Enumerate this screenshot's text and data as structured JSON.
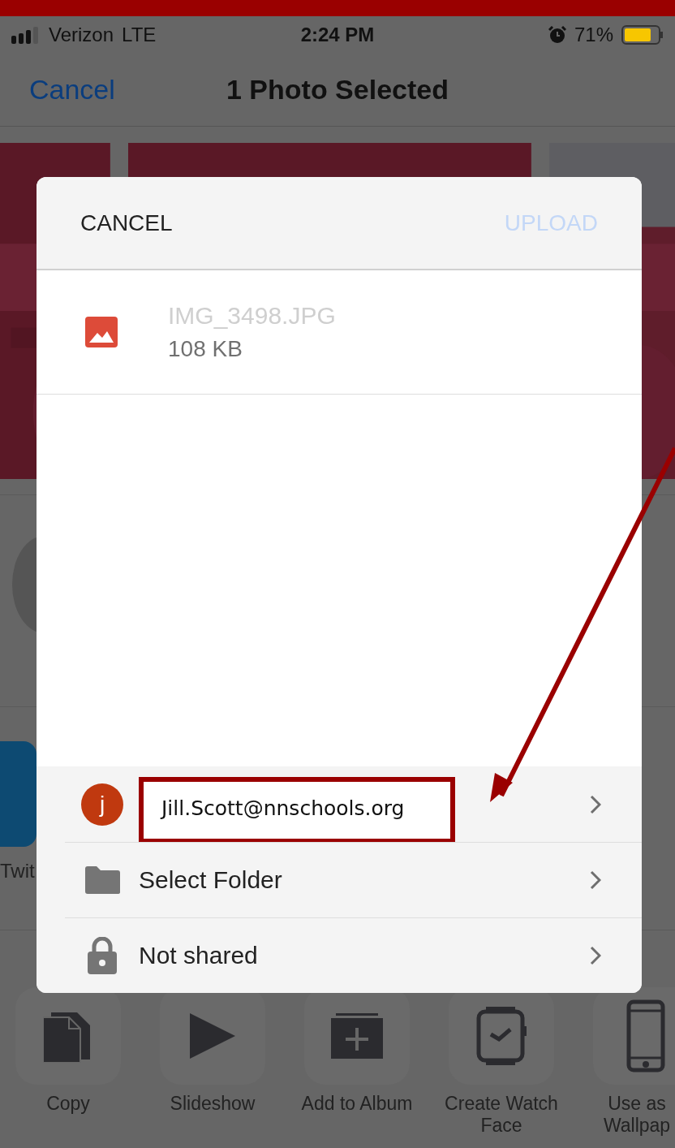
{
  "status_bar": {
    "carrier": "Verizon",
    "network": "LTE",
    "time": "2:24 PM",
    "battery": "71%"
  },
  "nav_bar": {
    "cancel": "Cancel",
    "title": "1 Photo Selected"
  },
  "share_apps": [
    {
      "label": "Twit"
    }
  ],
  "actions": [
    {
      "label": "Copy",
      "kind": "copy"
    },
    {
      "label": "Slideshow",
      "kind": "slideshow"
    },
    {
      "label": "Add to Album",
      "kind": "album"
    },
    {
      "label": "Create Watch Face",
      "kind": "watch"
    },
    {
      "label": "Use as Wallpap",
      "kind": "phone"
    }
  ],
  "dialog": {
    "cancel": "CANCEL",
    "upload": {
      "label": "UPLOAD",
      "disabled": true
    },
    "file": {
      "name": "IMG_3498.JPG",
      "size": "108 KB"
    },
    "account": {
      "avatar": "j",
      "email": "Jill.Scott@nnschools.org"
    },
    "rows": [
      {
        "label": "Select Folder",
        "kind": "folder"
      },
      {
        "label": "Not shared",
        "kind": "lock"
      }
    ]
  }
}
